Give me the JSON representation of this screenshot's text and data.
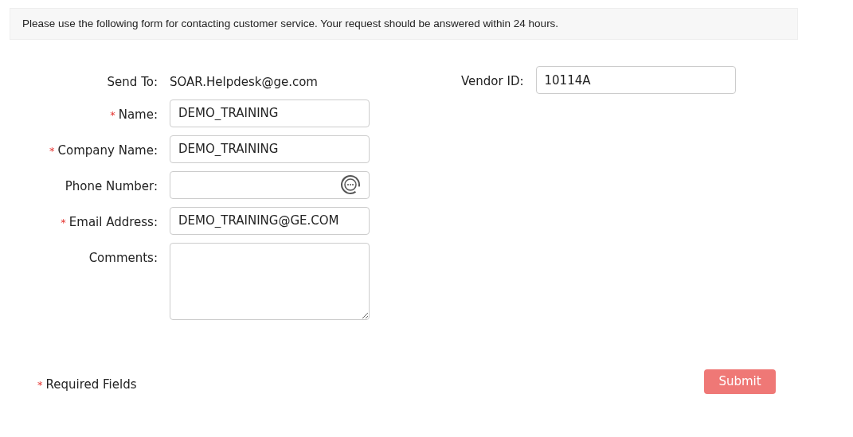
{
  "notice": "Please use the following form for contacting customer service. Your request should be answered within 24 hours.",
  "fields": [
    {
      "kind": "static",
      "label": "Send To:",
      "value": "SOAR.Helpdesk@ge.com"
    },
    {
      "kind": "text",
      "label": "Name:",
      "mark": "*",
      "value": "DEMO_TRAINING"
    },
    {
      "kind": "text",
      "label": "Company Name:",
      "mark": "*",
      "value": "DEMO_TRAINING"
    },
    {
      "kind": "phone",
      "label": "Phone Number:"
    },
    {
      "kind": "text",
      "label": "Email Address:",
      "mark": "*",
      "value": "DEMO_TRAINING@GE.COM"
    },
    {
      "kind": "textarea",
      "label": "Comments:"
    }
  ],
  "side_fields": [
    {
      "kind": "text",
      "label": "Vendor ID:",
      "value": "10114A"
    }
  ],
  "required_note": {
    "mark": "*",
    "text": "Required Fields"
  },
  "submit": "Submit"
}
